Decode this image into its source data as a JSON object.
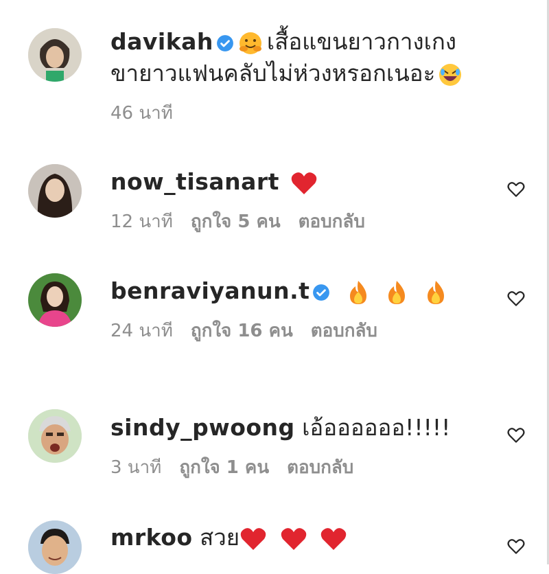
{
  "comments": [
    {
      "username": "davikah",
      "verified": true,
      "text_line1": "เสื้อแขนยาวกางเกง",
      "text_line2": "ขายาวแฟนคลับไม่ห่วงหรอกเนอะ",
      "time": "46 นาที",
      "likes": "",
      "reply": ""
    },
    {
      "username": "now_tisanart",
      "verified": false,
      "text": "",
      "time": "12 นาที",
      "likes": "ถูกใจ 5 คน",
      "reply": "ตอบกลับ"
    },
    {
      "username": "benraviyanun.t",
      "verified": true,
      "text": "",
      "time": "24 นาที",
      "likes": "ถูกใจ 16 คน",
      "reply": "ตอบกลับ"
    },
    {
      "username": "sindy_pwoong",
      "verified": false,
      "text": "เอ้ออออออ!!!!!",
      "time": "3 นาที",
      "likes": "ถูกใจ 1 คน",
      "reply": "ตอบกลับ"
    },
    {
      "username": "mrkoo",
      "verified": false,
      "text": "สวย",
      "time": "",
      "likes": "",
      "reply": ""
    }
  ],
  "colors": {
    "verified": "#3897f0",
    "meta": "#8e8e8e",
    "heart": "#ed4956"
  },
  "icons": {
    "like": "heart-outline-icon",
    "verified": "verified-badge-icon"
  }
}
